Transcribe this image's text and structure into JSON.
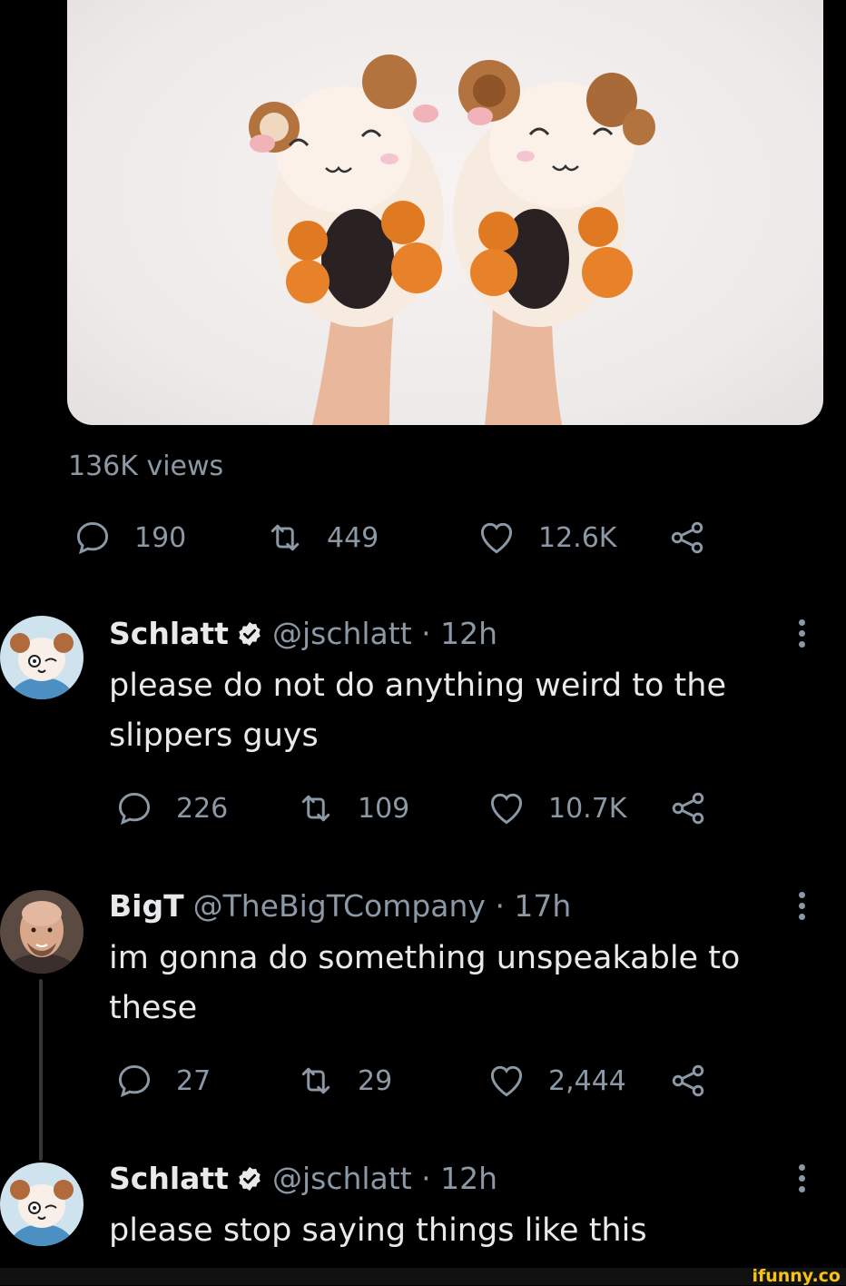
{
  "media": {
    "alt_icon": "ram-plush-slippers-photo"
  },
  "main_tweet": {
    "views": "136K views",
    "stats": {
      "replies": "190",
      "retweets": "449",
      "likes": "12.6K"
    }
  },
  "replies": [
    {
      "name": "Schlatt",
      "verified": true,
      "handle": "@jschlatt · 12h",
      "text": "please do not do anything weird to the slippers guys",
      "stats": {
        "replies": "226",
        "retweets": "109",
        "likes": "10.7K"
      }
    },
    {
      "name": "BigT",
      "verified": false,
      "handle": "@TheBigTCompany · 17h",
      "text": "im gonna do something unspeakable to these",
      "stats": {
        "replies": "27",
        "retweets": "29",
        "likes": "2,444"
      }
    },
    {
      "name": "Schlatt",
      "verified": true,
      "handle": "@jschlatt · 12h",
      "text": "please stop saying things like this"
    }
  ],
  "watermark": "ifunny.co",
  "colors": {
    "background": "#000000",
    "text": "#e7e9ea",
    "muted": "#8b98a5",
    "verified": "#e7e9ea",
    "watermark": "#f5c211"
  }
}
